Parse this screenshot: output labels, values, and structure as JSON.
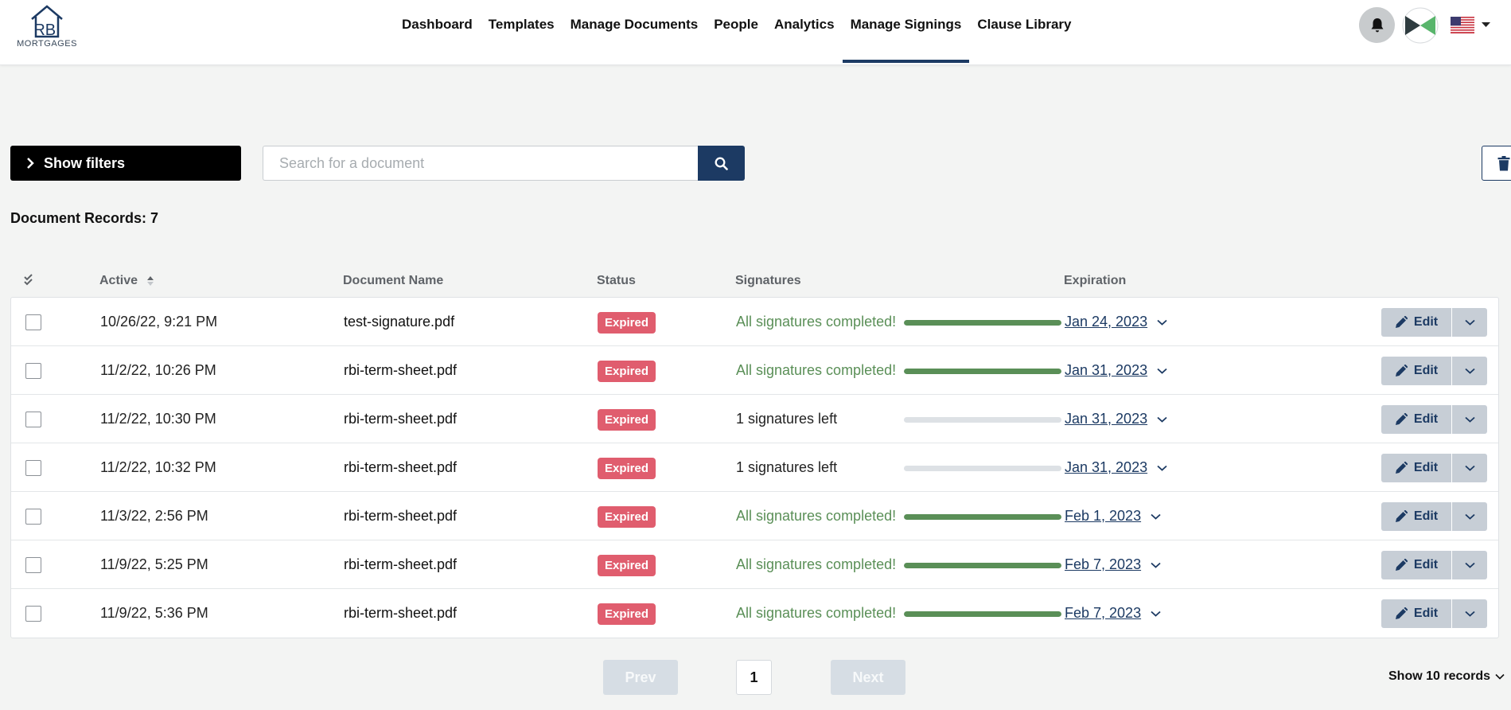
{
  "brand": {
    "logo_text": "RBI",
    "logo_sub": "MORTGAGES"
  },
  "nav": {
    "items": [
      {
        "label": "Dashboard"
      },
      {
        "label": "Templates"
      },
      {
        "label": "Manage Documents"
      },
      {
        "label": "People"
      },
      {
        "label": "Analytics"
      },
      {
        "label": "Manage Signings",
        "active": true
      },
      {
        "label": "Clause Library"
      }
    ]
  },
  "icons": {
    "bell": "bell-icon",
    "avatar": "avatar-icon",
    "flag": "us-flag-icon",
    "search": "search-icon",
    "trash": "trash-icon",
    "pencil": "pencil-icon",
    "chevron": "chevron-down-icon"
  },
  "colors": {
    "primary": "#1c3a63",
    "expired": "#e05d6e",
    "success": "#5a8f57"
  },
  "toolbar": {
    "show_filters_label": "Show filters",
    "search_placeholder": "Search for a document"
  },
  "summary": {
    "records_label": "Document Records: 7"
  },
  "table": {
    "columns": [
      "Active",
      "Document Name",
      "Status",
      "Signatures",
      "Expiration"
    ],
    "edit_label": "Edit",
    "rows": [
      {
        "active": "10/26/22, 9:21 PM",
        "document": "test-signature.pdf",
        "status": "Expired",
        "signatures": "All signatures completed!",
        "progress": 1.0,
        "expiration": "Jan 24, 2023"
      },
      {
        "active": "11/2/22, 10:26 PM",
        "document": "rbi-term-sheet.pdf",
        "status": "Expired",
        "signatures": "All signatures completed!",
        "progress": 1.0,
        "expiration": "Jan 31, 2023"
      },
      {
        "active": "11/2/22, 10:30 PM",
        "document": "rbi-term-sheet.pdf",
        "status": "Expired",
        "signatures": "1 signatures left",
        "progress": 0.0,
        "expiration": "Jan 31, 2023"
      },
      {
        "active": "11/2/22, 10:32 PM",
        "document": "rbi-term-sheet.pdf",
        "status": "Expired",
        "signatures": "1 signatures left",
        "progress": 0.0,
        "expiration": "Jan 31, 2023"
      },
      {
        "active": "11/3/22, 2:56 PM",
        "document": "rbi-term-sheet.pdf",
        "status": "Expired",
        "signatures": "All signatures completed!",
        "progress": 1.0,
        "expiration": "Feb 1, 2023"
      },
      {
        "active": "11/9/22, 5:25 PM",
        "document": "rbi-term-sheet.pdf",
        "status": "Expired",
        "signatures": "All signatures completed!",
        "progress": 1.0,
        "expiration": "Feb 7, 2023"
      },
      {
        "active": "11/9/22, 5:36 PM",
        "document": "rbi-term-sheet.pdf",
        "status": "Expired",
        "signatures": "All signatures completed!",
        "progress": 1.0,
        "expiration": "Feb 7, 2023"
      }
    ]
  },
  "pagination": {
    "prev_label": "Prev",
    "next_label": "Next",
    "current_page": "1",
    "show_records_label": "Show 10 records"
  }
}
